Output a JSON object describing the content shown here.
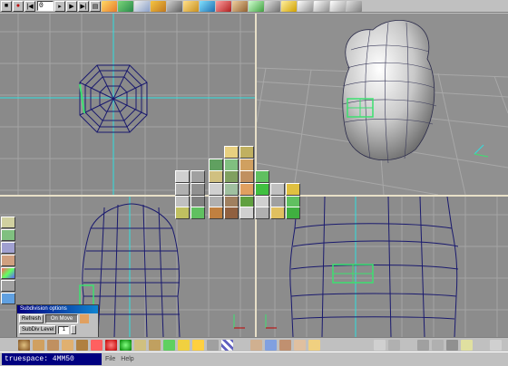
{
  "app": {
    "title": "truespace: 4MM50"
  },
  "toolbar": {
    "frame_value": "0"
  },
  "menu": {
    "items": [
      "File",
      "Help"
    ]
  },
  "subdivision": {
    "title": "Subdivision options",
    "refresh_label": "Refresh",
    "onmove_label": "On Move",
    "level_label": "SubDiv Level",
    "level_value": "1"
  },
  "colors": {
    "viewport_bg": "#8c8c8c",
    "grid": "#a8a8a8",
    "wireframe": "#1a1a6e",
    "selection": "#3ce070",
    "axis_cyan": "#2ee0e0",
    "separator": "#e8e0c8",
    "title_bar": "#000080"
  },
  "icons": [
    "play-icon",
    "stop-icon",
    "record-icon",
    "rewind-icon",
    "forward-icon",
    "render-icon",
    "move-icon",
    "rotate-icon",
    "scale-icon",
    "lathe-icon",
    "sweep-icon",
    "subdivide-icon",
    "material-icon",
    "undo-icon",
    "redo-icon"
  ]
}
